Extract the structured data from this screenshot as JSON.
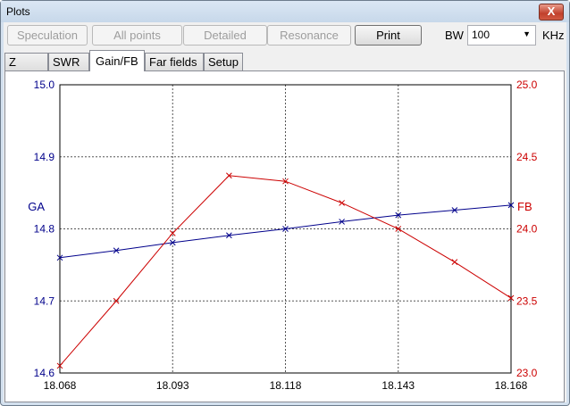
{
  "window": {
    "title": "Plots",
    "close_label": "X"
  },
  "toolbar": {
    "buttons": [
      {
        "label": "Speculation",
        "enabled": false
      },
      {
        "label": "All points",
        "enabled": false
      },
      {
        "label": "Detailed",
        "enabled": false
      },
      {
        "label": "Resonance",
        "enabled": false
      },
      {
        "label": "Print",
        "enabled": true
      }
    ],
    "bw_label": "BW",
    "bw_value": "100",
    "bw_unit": "KHz"
  },
  "tabs": [
    {
      "label": "Z",
      "active": false
    },
    {
      "label": "SWR",
      "active": false
    },
    {
      "label": "Gain/FB",
      "active": true
    },
    {
      "label": "Far fields",
      "active": false
    },
    {
      "label": "Setup",
      "active": false
    }
  ],
  "chart_data": {
    "type": "line",
    "x": [
      18.068,
      18.0805,
      18.093,
      18.1055,
      18.118,
      18.1305,
      18.143,
      18.1555,
      18.168
    ],
    "x_ticks": [
      "18.068",
      "18.093",
      "18.118",
      "18.143",
      "18.168"
    ],
    "xlim": [
      18.068,
      18.168
    ],
    "left_axis": {
      "label": "GA",
      "ylim": [
        14.6,
        15.0
      ],
      "ticks": [
        "15.0",
        "14.9",
        "14.8",
        "14.7",
        "14.6"
      ],
      "color": "#00008b"
    },
    "right_axis": {
      "label": "FB",
      "ylim": [
        23.0,
        25.0
      ],
      "ticks": [
        "25.0",
        "24.5",
        "24.0",
        "23.5",
        "23.0"
      ],
      "color": "#cc0000"
    },
    "series": [
      {
        "axis": "left",
        "color": "#00008b",
        "values": [
          14.76,
          14.77,
          14.781,
          14.791,
          14.8,
          14.81,
          14.819,
          14.826,
          14.833
        ]
      },
      {
        "axis": "right",
        "color": "#cc0000",
        "values": [
          23.05,
          23.5,
          23.97,
          24.37,
          24.33,
          24.18,
          24.0,
          23.77,
          23.52
        ]
      }
    ],
    "grid": true
  }
}
